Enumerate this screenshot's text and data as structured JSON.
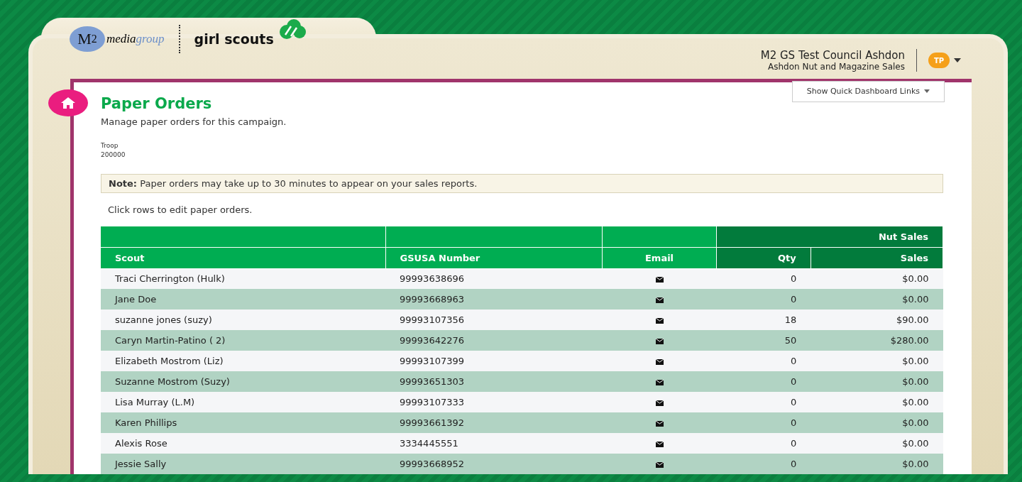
{
  "header": {
    "logo_left": {
      "mark": "M",
      "mark_sub": "2",
      "word_a": "media",
      "word_b": "group"
    },
    "logo_right": "girl scouts",
    "council": "M2 GS Test Council Ashdon",
    "campaign": "Ashdon Nut and Magazine Sales",
    "avatar": "TP"
  },
  "page": {
    "title": "Paper Orders",
    "subtitle": "Manage paper orders for this campaign.",
    "quick_links": "Show Quick Dashboard Links",
    "troop_label": "Troop",
    "troop_value": "200000",
    "note": "**Note:** Paper orders may take up to 30 minutes to appear on your sales reports.",
    "hint": "Click rows to edit paper orders."
  },
  "table": {
    "group_header": "Nut Sales",
    "columns": [
      "Scout",
      "GSUSA Number",
      "Email",
      "Qty",
      "Sales"
    ],
    "rows": [
      {
        "scout": "Traci Cherrington (Hulk)",
        "gsusa": "99993638696",
        "qty": "0",
        "sales": "$0.00"
      },
      {
        "scout": "Jane Doe",
        "gsusa": "99993668963",
        "qty": "0",
        "sales": "$0.00"
      },
      {
        "scout": "suzanne jones (suzy)",
        "gsusa": "99993107356",
        "qty": "18",
        "sales": "$90.00"
      },
      {
        "scout": "Caryn Martin-Patino ( 2)",
        "gsusa": "99993642276",
        "qty": "50",
        "sales": "$280.00"
      },
      {
        "scout": "Elizabeth Mostrom (Liz)",
        "gsusa": "99993107399",
        "qty": "0",
        "sales": "$0.00"
      },
      {
        "scout": "Suzanne Mostrom (Suzy)",
        "gsusa": "99993651303",
        "qty": "0",
        "sales": "$0.00"
      },
      {
        "scout": "Lisa Murray (L.M)",
        "gsusa": "99993107333",
        "qty": "0",
        "sales": "$0.00"
      },
      {
        "scout": "Karen Phillips",
        "gsusa": "99993661392",
        "qty": "0",
        "sales": "$0.00"
      },
      {
        "scout": "Alexis Rose",
        "gsusa": "3334445551",
        "qty": "0",
        "sales": "$0.00"
      },
      {
        "scout": "Jessie Sally",
        "gsusa": "99993668952",
        "qty": "0",
        "sales": "$0.00"
      }
    ]
  }
}
